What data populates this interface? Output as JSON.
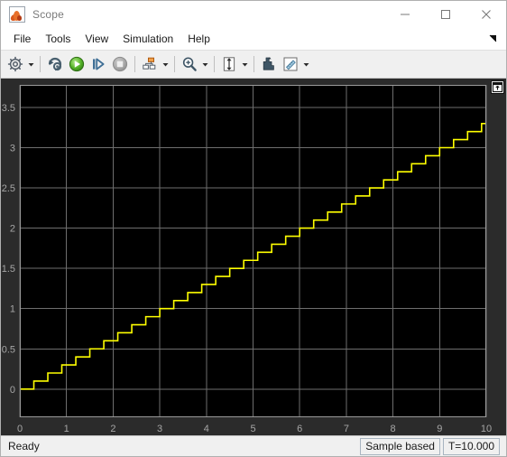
{
  "window": {
    "title": "Scope",
    "app_icon": "matlab-membrane-icon",
    "controls": [
      {
        "name": "minimize",
        "glyph": "minimize-icon"
      },
      {
        "name": "maximize",
        "glyph": "maximize-icon"
      },
      {
        "name": "close",
        "glyph": "close-icon"
      }
    ]
  },
  "menubar": {
    "items": [
      {
        "label": "File"
      },
      {
        "label": "Tools"
      },
      {
        "label": "View"
      },
      {
        "label": "Simulation"
      },
      {
        "label": "Help"
      }
    ],
    "overflow_icon": "overflow-arrow-icon"
  },
  "toolbar": {
    "groups": [
      {
        "buttons": [
          {
            "name": "configuration-properties-button",
            "icon": "gear-icon",
            "has_dropdown": true
          }
        ]
      },
      {
        "buttons": [
          {
            "name": "run-back-to-start-button",
            "icon": "rewind-icon",
            "has_dropdown": false
          },
          {
            "name": "run-button",
            "icon": "play-icon",
            "has_dropdown": false
          },
          {
            "name": "step-forward-button",
            "icon": "step-forward-icon",
            "has_dropdown": false
          },
          {
            "name": "stop-button",
            "icon": "stop-icon",
            "has_dropdown": false
          }
        ]
      },
      {
        "buttons": [
          {
            "name": "layout-button",
            "icon": "layout-icon",
            "has_dropdown": true
          }
        ]
      },
      {
        "buttons": [
          {
            "name": "zoom-in-button",
            "icon": "zoom-in-icon",
            "has_dropdown": true
          }
        ]
      },
      {
        "buttons": [
          {
            "name": "autoscale-button",
            "icon": "autoscale-icon",
            "has_dropdown": true
          }
        ]
      },
      {
        "buttons": [
          {
            "name": "axes-scaling-button",
            "icon": "axes-scaling-icon",
            "has_dropdown": false
          },
          {
            "name": "cursor-measurements-button",
            "icon": "ruler-icon",
            "has_dropdown": true
          }
        ]
      }
    ]
  },
  "scope": {
    "dock_button_name": "dock-undock-button",
    "dock_button_icon": "undock-icon",
    "background": "#000000",
    "panel_background": "#2b2b2b",
    "grid_color": "#6e6e6e",
    "axis_color": "#9a9a9a",
    "tick_label_color": "#a6a6a6",
    "trace_color": "#ffff00"
  },
  "statusbar": {
    "status": "Ready",
    "panes": [
      {
        "name": "frame-mode-pane",
        "label": "Sample based"
      },
      {
        "name": "simulation-time-pane",
        "label": "T=10.000"
      }
    ]
  },
  "chart_data": {
    "type": "line",
    "title": "",
    "xlabel": "",
    "ylabel": "",
    "xlim": [
      0,
      10
    ],
    "ylim": [
      -0.35,
      3.78
    ],
    "xticks": [
      0,
      1,
      2,
      3,
      4,
      5,
      6,
      7,
      8,
      9,
      10
    ],
    "xticklabels": [
      "0",
      "1",
      "2",
      "3",
      "4",
      "5",
      "6",
      "7",
      "8",
      "9",
      "10"
    ],
    "yticks": [
      0,
      0.5,
      1,
      1.5,
      2,
      2.5,
      3,
      3.5
    ],
    "yticklabels": [
      "0",
      "0.5",
      "1",
      "1.5",
      "2",
      "2.5",
      "3",
      "3.5"
    ],
    "grid": true,
    "legend": null,
    "series": [
      {
        "name": "quantized-ramp",
        "color": "#ffff00",
        "style": "staircase",
        "description": "Quantized ramp signal: staircase rising from 0 to ~3.25 over t=0..10, step width 0.3 s, step height 0.1",
        "step_width": 0.3,
        "step_height": 0.1,
        "x": [
          0.0,
          0.3,
          0.3,
          0.6,
          0.6,
          0.9,
          0.9,
          1.2,
          1.2,
          1.5,
          1.5,
          1.8,
          1.8,
          2.1,
          2.1,
          2.4,
          2.4,
          2.7,
          2.7,
          3.0,
          3.0,
          3.3,
          3.3,
          3.6,
          3.6,
          3.9,
          3.9,
          4.2,
          4.2,
          4.5,
          4.5,
          4.8,
          4.8,
          5.1,
          5.1,
          5.4,
          5.4,
          5.7,
          5.7,
          6.0,
          6.0,
          6.3,
          6.3,
          6.6,
          6.6,
          6.9,
          6.9,
          7.2,
          7.2,
          7.5,
          7.5,
          7.8,
          7.8,
          8.1,
          8.1,
          8.4,
          8.4,
          8.7,
          8.7,
          9.0,
          9.0,
          9.3,
          9.3,
          9.6,
          9.6,
          9.9,
          9.9,
          10.0
        ],
        "y": [
          0.0,
          0.0,
          0.1,
          0.1,
          0.2,
          0.2,
          0.3,
          0.3,
          0.4,
          0.4,
          0.5,
          0.5,
          0.6,
          0.6,
          0.7,
          0.7,
          0.8,
          0.8,
          0.9,
          0.9,
          1.0,
          1.0,
          1.1,
          1.1,
          1.2,
          1.2,
          1.3,
          1.3,
          1.4,
          1.4,
          1.5,
          1.5,
          1.6,
          1.6,
          1.7,
          1.7,
          1.8,
          1.8,
          1.9,
          1.9,
          2.0,
          2.0,
          2.1,
          2.1,
          2.2,
          2.2,
          2.3,
          2.3,
          2.4,
          2.4,
          2.5,
          2.5,
          2.6,
          2.6,
          2.7,
          2.7,
          2.8,
          2.8,
          2.9,
          2.9,
          3.0,
          3.0,
          3.1,
          3.1,
          3.2,
          3.2,
          3.3,
          3.3
        ]
      }
    ]
  }
}
